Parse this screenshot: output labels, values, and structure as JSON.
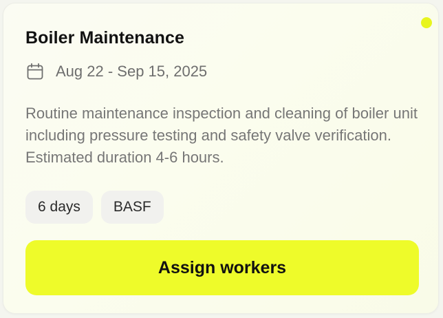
{
  "card": {
    "title": "Boiler Maintenance",
    "date_range": "Aug 22 - Sep 15, 2025",
    "description": "Routine maintenance inspection and cleaning of boiler unit including pressure testing and safety valve verification. Estimated duration 4-6 hours.",
    "tags": [
      {
        "label": "6 days"
      },
      {
        "label": "BASF"
      }
    ],
    "assign_button_label": "Assign workers"
  },
  "icons": {
    "date": "calendar-icon",
    "status": "status-dot"
  },
  "colors": {
    "accent": "#eefb2a",
    "status_dot": "#e8f51e",
    "title": "#111111",
    "muted_text": "#767676",
    "tag_background": "#f1f1ee"
  }
}
